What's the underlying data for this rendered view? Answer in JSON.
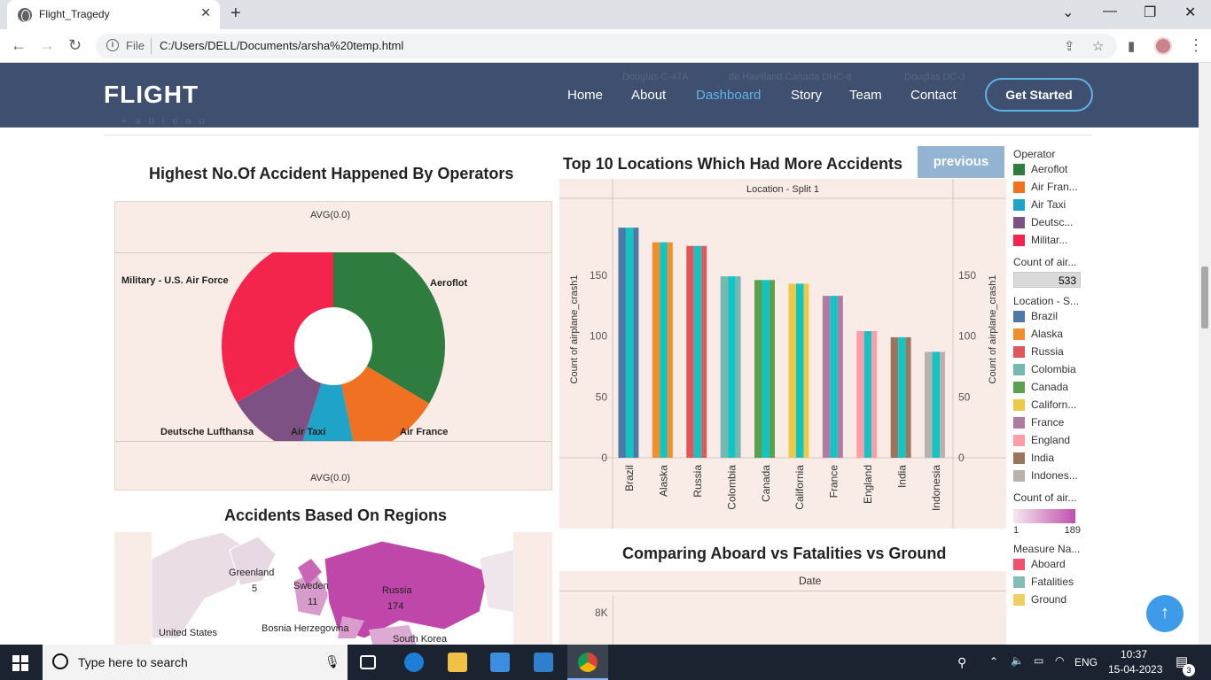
{
  "browser": {
    "tab_title": "Flight_Tragedy",
    "url_scheme": "File",
    "url": "C:/Users/DELL/Documents/arsha%20temp.html"
  },
  "navbar": {
    "brand": "FLIGHT",
    "links": [
      "Home",
      "About",
      "Dashboard",
      "Story",
      "Team",
      "Contact"
    ],
    "active": "Dashboard",
    "cta": "Get Started",
    "ghost_labels": [
      "Douglas C-47A",
      "de Havilland Canada DHC-6",
      "Douglas DC-3"
    ],
    "ghost_logo": "+ a b l e a u"
  },
  "dashboard": {
    "pie_title": "Highest No.Of Accident Happened By Operators",
    "pie_avg_top": "AVG(0.0)",
    "pie_avg_bottom": "AVG(0.0)",
    "bar_title": "Top 10 Locations Which Had More Accidents",
    "bar_header": "Location - Split 1",
    "bar_ylabel": "Count of airplane_crash1",
    "previous": "previous",
    "map_title": "Accidents Based On Regions",
    "map_labels": [
      {
        "name": "Greenland",
        "value": "5"
      },
      {
        "name": "Sweden",
        "value": "11"
      },
      {
        "name": "Russia",
        "value": "174"
      },
      {
        "name": "United States",
        "value": ""
      },
      {
        "name": "Bosnia Herzegovina",
        "value": ""
      },
      {
        "name": "South Korea",
        "value": ""
      }
    ],
    "cmp_title": "Comparing Aboard vs Fatalities vs Ground",
    "cmp_header": "Date",
    "cmp_ytick": "8K"
  },
  "legend": {
    "operator_title": "Operator",
    "operators": [
      {
        "label": "Aeroflot",
        "color": "#2e7d3f"
      },
      {
        "label": "Air Fran...",
        "color": "#f07121"
      },
      {
        "label": "Air Taxi",
        "color": "#1fa3c9"
      },
      {
        "label": "Deutsc...",
        "color": "#7e5184"
      },
      {
        "label": "Militar...",
        "color": "#f4254d"
      }
    ],
    "count_title": "Count of air...",
    "count_value": "533",
    "location_title": "Location - S...",
    "locations": [
      {
        "label": "Brazil",
        "color": "#4e79a7"
      },
      {
        "label": "Alaska",
        "color": "#f28e2b"
      },
      {
        "label": "Russia",
        "color": "#e15759"
      },
      {
        "label": "Colombia",
        "color": "#76b7b2"
      },
      {
        "label": "Canada",
        "color": "#59a14f"
      },
      {
        "label": "Californ...",
        "color": "#edc948"
      },
      {
        "label": "France",
        "color": "#b07aa1"
      },
      {
        "label": "England",
        "color": "#ff9da7"
      },
      {
        "label": "India",
        "color": "#9c755f"
      },
      {
        "label": "Indones...",
        "color": "#bab0ac"
      }
    ],
    "count2_title": "Count of air...",
    "grad_min": "1",
    "grad_max": "189",
    "measure_title": "Measure Na...",
    "measures": [
      {
        "label": "Aboard",
        "color": "#f0506e"
      },
      {
        "label": "Fatalities",
        "color": "#86bcb6"
      },
      {
        "label": "Ground",
        "color": "#f1ce63"
      }
    ]
  },
  "chart_data": [
    {
      "type": "pie",
      "title": "Highest No.Of Accident Happened By Operators",
      "categories": [
        "Aeroflot",
        "Air France",
        "Air Taxi",
        "Deutsche Lufthansa",
        "Military - U.S. Air Force"
      ],
      "values": [
        179,
        70,
        44,
        62,
        178
      ],
      "colors": [
        "#2e7d3f",
        "#f07121",
        "#1fa3c9",
        "#7e5184",
        "#f4254d"
      ]
    },
    {
      "type": "bar",
      "title": "Top 10 Locations Which Had More Accidents",
      "categories": [
        "Brazil",
        "Alaska",
        "Russia",
        "Colombia",
        "Canada",
        "California",
        "France",
        "England",
        "India",
        "Indonesia"
      ],
      "series": [
        {
          "values": [
            189,
            177,
            174,
            149,
            146,
            143,
            133,
            104,
            99,
            87
          ]
        },
        {
          "values": [
            189,
            177,
            174,
            149,
            146,
            143,
            133,
            104,
            99,
            87
          ]
        }
      ],
      "ylabel": "Count of airplane_crash1",
      "ylim": [
        0,
        200
      ],
      "yticks": [
        0,
        50,
        100,
        150
      ],
      "colors": [
        "#4e79a7",
        "#f28e2b",
        "#e15759",
        "#76b7b2",
        "#59a14f",
        "#edc948",
        "#b07aa1",
        "#ff9da7",
        "#9c755f",
        "#bab0ac"
      ],
      "second_color": "#12c4c4"
    }
  ],
  "taskbar": {
    "search_placeholder": "Type here to search",
    "lang": "ENG",
    "time": "10:37",
    "date": "15-04-2023",
    "notif": "3"
  }
}
